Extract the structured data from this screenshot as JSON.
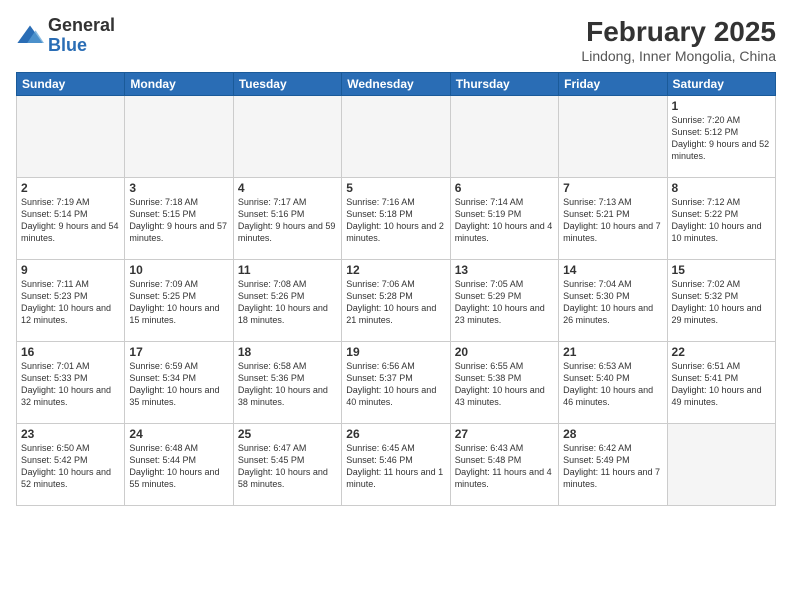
{
  "logo": {
    "general": "General",
    "blue": "Blue"
  },
  "header": {
    "month": "February 2025",
    "location": "Lindong, Inner Mongolia, China"
  },
  "weekdays": [
    "Sunday",
    "Monday",
    "Tuesday",
    "Wednesday",
    "Thursday",
    "Friday",
    "Saturday"
  ],
  "weeks": [
    [
      {
        "day": "",
        "info": ""
      },
      {
        "day": "",
        "info": ""
      },
      {
        "day": "",
        "info": ""
      },
      {
        "day": "",
        "info": ""
      },
      {
        "day": "",
        "info": ""
      },
      {
        "day": "",
        "info": ""
      },
      {
        "day": "1",
        "info": "Sunrise: 7:20 AM\nSunset: 5:12 PM\nDaylight: 9 hours and 52 minutes."
      }
    ],
    [
      {
        "day": "2",
        "info": "Sunrise: 7:19 AM\nSunset: 5:14 PM\nDaylight: 9 hours and 54 minutes."
      },
      {
        "day": "3",
        "info": "Sunrise: 7:18 AM\nSunset: 5:15 PM\nDaylight: 9 hours and 57 minutes."
      },
      {
        "day": "4",
        "info": "Sunrise: 7:17 AM\nSunset: 5:16 PM\nDaylight: 9 hours and 59 minutes."
      },
      {
        "day": "5",
        "info": "Sunrise: 7:16 AM\nSunset: 5:18 PM\nDaylight: 10 hours and 2 minutes."
      },
      {
        "day": "6",
        "info": "Sunrise: 7:14 AM\nSunset: 5:19 PM\nDaylight: 10 hours and 4 minutes."
      },
      {
        "day": "7",
        "info": "Sunrise: 7:13 AM\nSunset: 5:21 PM\nDaylight: 10 hours and 7 minutes."
      },
      {
        "day": "8",
        "info": "Sunrise: 7:12 AM\nSunset: 5:22 PM\nDaylight: 10 hours and 10 minutes."
      }
    ],
    [
      {
        "day": "9",
        "info": "Sunrise: 7:11 AM\nSunset: 5:23 PM\nDaylight: 10 hours and 12 minutes."
      },
      {
        "day": "10",
        "info": "Sunrise: 7:09 AM\nSunset: 5:25 PM\nDaylight: 10 hours and 15 minutes."
      },
      {
        "day": "11",
        "info": "Sunrise: 7:08 AM\nSunset: 5:26 PM\nDaylight: 10 hours and 18 minutes."
      },
      {
        "day": "12",
        "info": "Sunrise: 7:06 AM\nSunset: 5:28 PM\nDaylight: 10 hours and 21 minutes."
      },
      {
        "day": "13",
        "info": "Sunrise: 7:05 AM\nSunset: 5:29 PM\nDaylight: 10 hours and 23 minutes."
      },
      {
        "day": "14",
        "info": "Sunrise: 7:04 AM\nSunset: 5:30 PM\nDaylight: 10 hours and 26 minutes."
      },
      {
        "day": "15",
        "info": "Sunrise: 7:02 AM\nSunset: 5:32 PM\nDaylight: 10 hours and 29 minutes."
      }
    ],
    [
      {
        "day": "16",
        "info": "Sunrise: 7:01 AM\nSunset: 5:33 PM\nDaylight: 10 hours and 32 minutes."
      },
      {
        "day": "17",
        "info": "Sunrise: 6:59 AM\nSunset: 5:34 PM\nDaylight: 10 hours and 35 minutes."
      },
      {
        "day": "18",
        "info": "Sunrise: 6:58 AM\nSunset: 5:36 PM\nDaylight: 10 hours and 38 minutes."
      },
      {
        "day": "19",
        "info": "Sunrise: 6:56 AM\nSunset: 5:37 PM\nDaylight: 10 hours and 40 minutes."
      },
      {
        "day": "20",
        "info": "Sunrise: 6:55 AM\nSunset: 5:38 PM\nDaylight: 10 hours and 43 minutes."
      },
      {
        "day": "21",
        "info": "Sunrise: 6:53 AM\nSunset: 5:40 PM\nDaylight: 10 hours and 46 minutes."
      },
      {
        "day": "22",
        "info": "Sunrise: 6:51 AM\nSunset: 5:41 PM\nDaylight: 10 hours and 49 minutes."
      }
    ],
    [
      {
        "day": "23",
        "info": "Sunrise: 6:50 AM\nSunset: 5:42 PM\nDaylight: 10 hours and 52 minutes."
      },
      {
        "day": "24",
        "info": "Sunrise: 6:48 AM\nSunset: 5:44 PM\nDaylight: 10 hours and 55 minutes."
      },
      {
        "day": "25",
        "info": "Sunrise: 6:47 AM\nSunset: 5:45 PM\nDaylight: 10 hours and 58 minutes."
      },
      {
        "day": "26",
        "info": "Sunrise: 6:45 AM\nSunset: 5:46 PM\nDaylight: 11 hours and 1 minute."
      },
      {
        "day": "27",
        "info": "Sunrise: 6:43 AM\nSunset: 5:48 PM\nDaylight: 11 hours and 4 minutes."
      },
      {
        "day": "28",
        "info": "Sunrise: 6:42 AM\nSunset: 5:49 PM\nDaylight: 11 hours and 7 minutes."
      },
      {
        "day": "",
        "info": ""
      }
    ]
  ]
}
